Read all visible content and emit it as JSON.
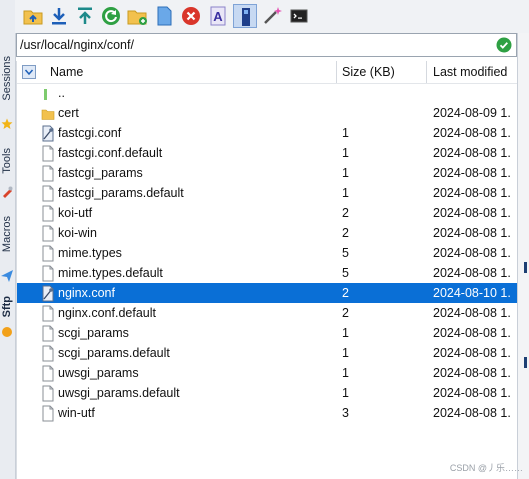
{
  "sidebar": {
    "tabs": [
      {
        "label": "Sessions",
        "icon": "star-icon"
      },
      {
        "label": "Tools",
        "icon": "tools-icon"
      },
      {
        "label": "Macros",
        "icon": "paper-plane-icon"
      },
      {
        "label": "Sftp",
        "icon": "sftp-icon"
      }
    ]
  },
  "toolbar": {
    "buttons": [
      {
        "name": "parent-folder-button",
        "icon": "folder-up-icon"
      },
      {
        "name": "download-button",
        "icon": "download-arrow-icon"
      },
      {
        "name": "upload-button",
        "icon": "upload-arrow-icon"
      },
      {
        "name": "refresh-button",
        "icon": "refresh-icon"
      },
      {
        "name": "new-folder-button",
        "icon": "folder-add-icon"
      },
      {
        "name": "new-file-button",
        "icon": "new-file-icon"
      },
      {
        "name": "delete-button",
        "icon": "delete-icon"
      },
      {
        "name": "text-mode-button",
        "icon": "letter-a-icon"
      },
      {
        "name": "bookmark-button",
        "icon": "bookmark-icon"
      },
      {
        "name": "magic-wand-button",
        "icon": "magic-wand-icon"
      },
      {
        "name": "terminal-button",
        "icon": "terminal-icon"
      }
    ]
  },
  "path": {
    "value": "/usr/local/nginx/conf/"
  },
  "columns": {
    "name": "Name",
    "size": "Size (KB)",
    "modified": "Last modified"
  },
  "files": [
    {
      "name": "..",
      "size": "",
      "modified": "",
      "type": "parent"
    },
    {
      "name": "cert",
      "size": "",
      "modified": "2024-08-09 1.",
      "type": "folder"
    },
    {
      "name": "fastcgi.conf",
      "size": "1",
      "modified": "2024-08-08 1.",
      "type": "conf"
    },
    {
      "name": "fastcgi.conf.default",
      "size": "1",
      "modified": "2024-08-08 1.",
      "type": "file"
    },
    {
      "name": "fastcgi_params",
      "size": "1",
      "modified": "2024-08-08 1.",
      "type": "file"
    },
    {
      "name": "fastcgi_params.default",
      "size": "1",
      "modified": "2024-08-08 1.",
      "type": "file"
    },
    {
      "name": "koi-utf",
      "size": "2",
      "modified": "2024-08-08 1.",
      "type": "file"
    },
    {
      "name": "koi-win",
      "size": "2",
      "modified": "2024-08-08 1.",
      "type": "file"
    },
    {
      "name": "mime.types",
      "size": "5",
      "modified": "2024-08-08 1.",
      "type": "file"
    },
    {
      "name": "mime.types.default",
      "size": "5",
      "modified": "2024-08-08 1.",
      "type": "file"
    },
    {
      "name": "nginx.conf",
      "size": "2",
      "modified": "2024-08-10 1.",
      "type": "conf",
      "selected": true
    },
    {
      "name": "nginx.conf.default",
      "size": "2",
      "modified": "2024-08-08 1.",
      "type": "file"
    },
    {
      "name": "scgi_params",
      "size": "1",
      "modified": "2024-08-08 1.",
      "type": "file"
    },
    {
      "name": "scgi_params.default",
      "size": "1",
      "modified": "2024-08-08 1.",
      "type": "file"
    },
    {
      "name": "uwsgi_params",
      "size": "1",
      "modified": "2024-08-08 1.",
      "type": "file"
    },
    {
      "name": "uwsgi_params.default",
      "size": "1",
      "modified": "2024-08-08 1.",
      "type": "file"
    },
    {
      "name": "win-utf",
      "size": "3",
      "modified": "2024-08-08 1.",
      "type": "file"
    }
  ],
  "watermark": "CSDN @丿乐……",
  "colors": {
    "selection": "#0a6fd6",
    "folder": "#f2c14e",
    "accent": "#1d5fb8"
  }
}
